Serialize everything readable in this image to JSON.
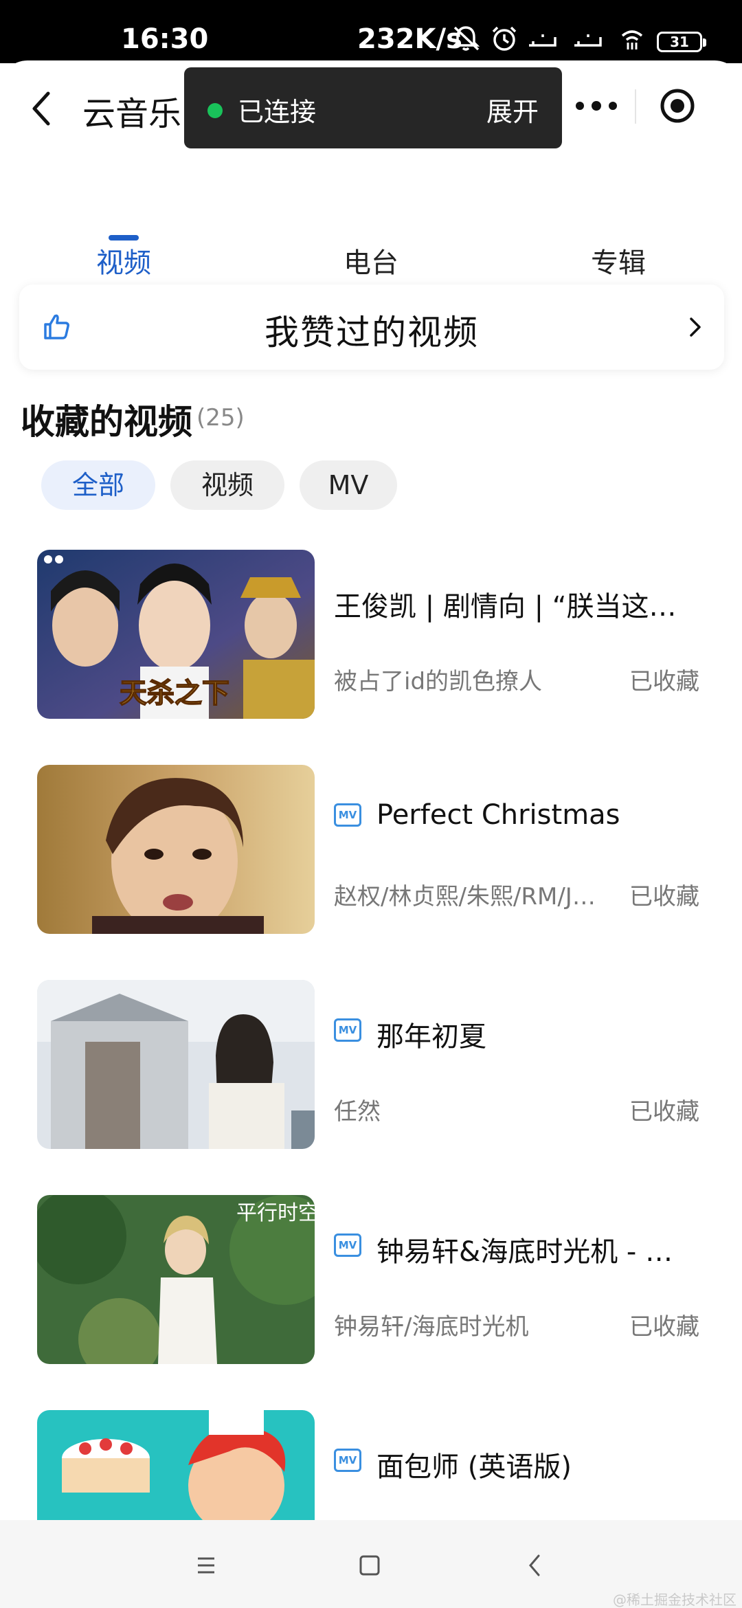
{
  "status_bar": {
    "time": "16:30",
    "net_speed": "232K/s",
    "battery": "31"
  },
  "header": {
    "app_title": "云音乐",
    "toast_status": "已连接",
    "toast_action": "展开",
    "status_color": "#19c25a"
  },
  "tabs": [
    {
      "label": "视频",
      "active": true
    },
    {
      "label": "电台",
      "active": false
    },
    {
      "label": "专辑",
      "active": false
    }
  ],
  "liked_card": {
    "label": "我赞过的视频"
  },
  "section": {
    "title": "收藏的视频",
    "count": "(25)"
  },
  "filters": [
    {
      "label": "全部",
      "active": true
    },
    {
      "label": "视频",
      "active": false
    },
    {
      "label": "MV",
      "active": false
    }
  ],
  "mv_badge_text": "MV",
  "videos": [
    {
      "title": "王俊凯 | 剧情向 | “朕当这个…",
      "author": "被占了id的凯色撩人",
      "state": "已收藏",
      "is_mv": false,
      "cover_text": "天杀之下"
    },
    {
      "title": "Perfect Christmas",
      "author": "赵权/林贞熙/朱熙/RM/Ju…",
      "state": "已收藏",
      "is_mv": true,
      "cover_text": ""
    },
    {
      "title": "那年初夏",
      "author": "任然",
      "state": "已收藏",
      "is_mv": true,
      "cover_text": ""
    },
    {
      "title": "钟易轩&海底时光机 - 平…",
      "author": "钟易轩/海底时光机",
      "state": "已收藏",
      "is_mv": true,
      "cover_text": "平行时空"
    },
    {
      "title": "面包师 (英语版)",
      "author": "",
      "state": "",
      "is_mv": true,
      "cover_text": ""
    }
  ],
  "watermark": "@稀土掘金技术社区",
  "accent_color": "#1e5fc8"
}
